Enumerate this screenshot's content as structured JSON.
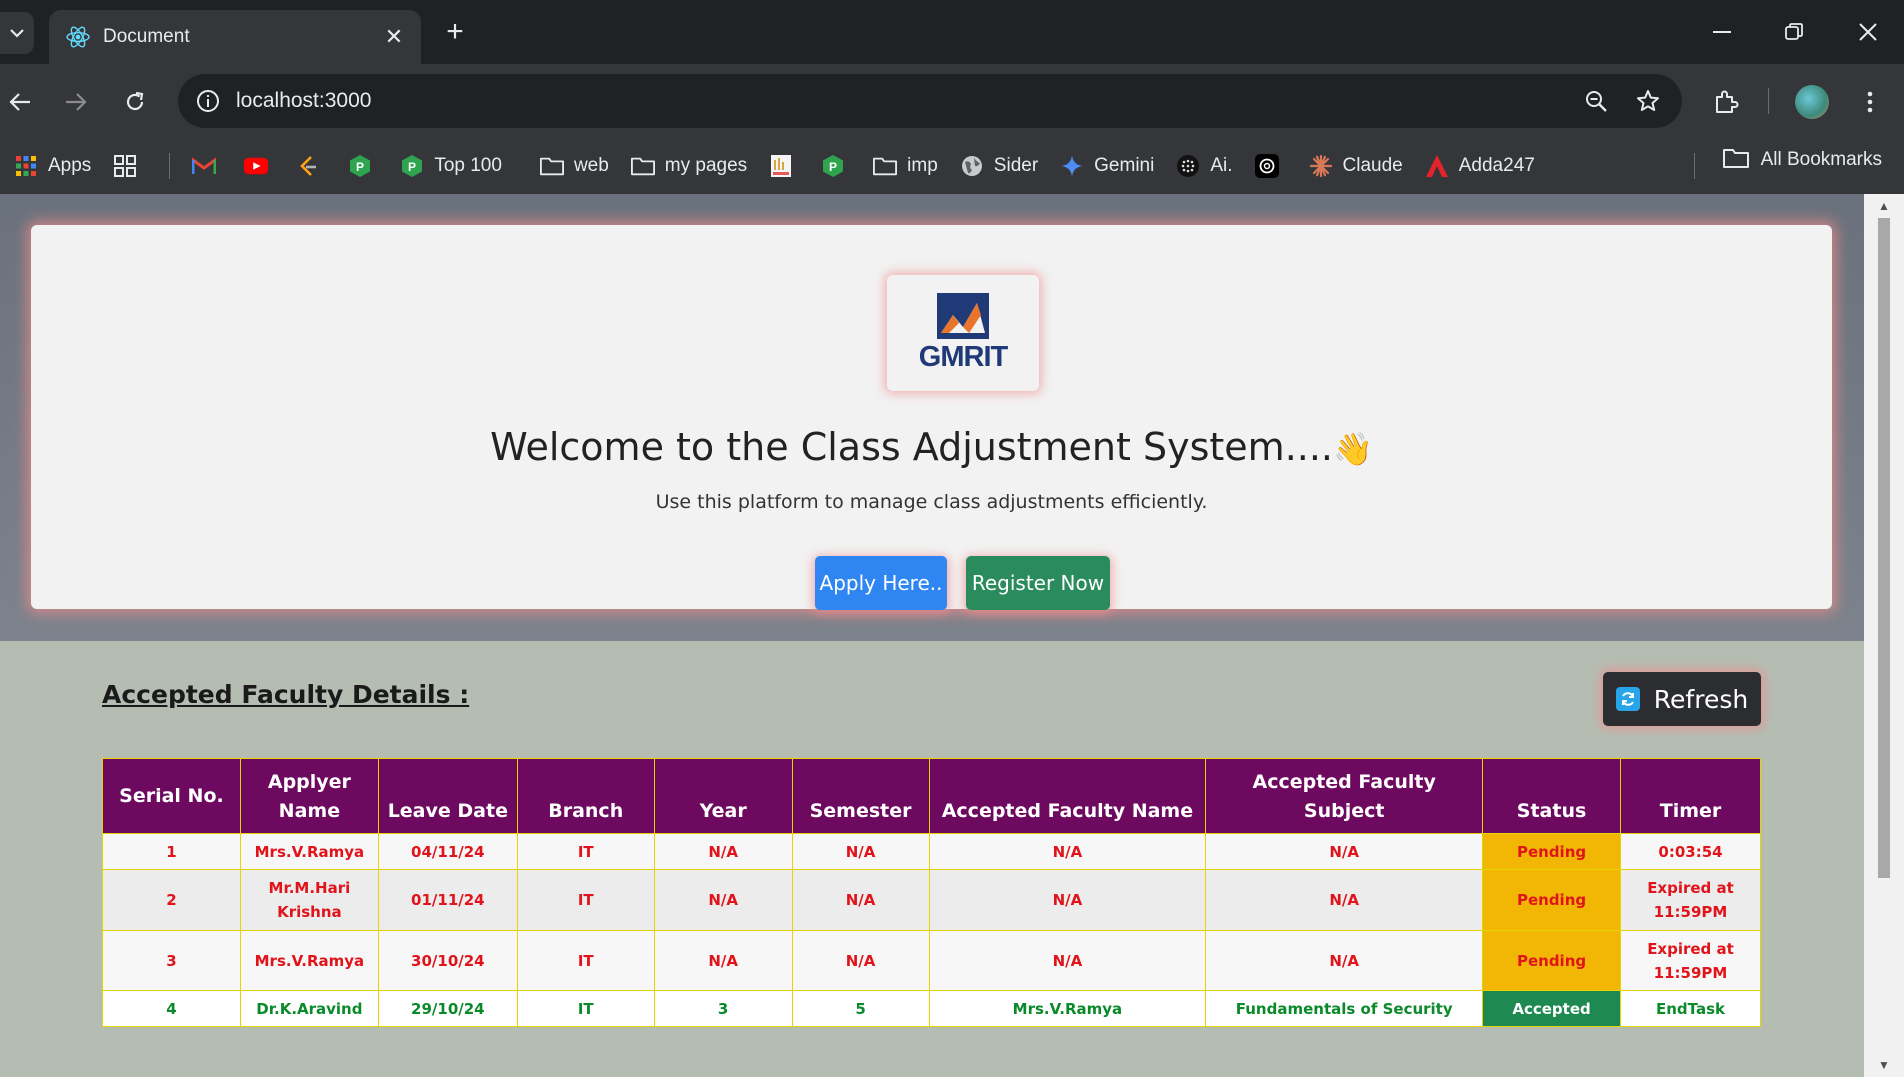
{
  "browser": {
    "tab_title": "Document",
    "url": "localhost:3000"
  },
  "bookmarks": {
    "items": [
      "Apps",
      "",
      "",
      "",
      "",
      "",
      "Top 100",
      "web",
      "my pages",
      "",
      "",
      "imp",
      "Sider",
      "Gemini",
      "Ai.",
      "",
      "Claude",
      "Adda247"
    ],
    "all_label": "All Bookmarks"
  },
  "hero": {
    "logo_text": "GMRIT",
    "welcome": "Welcome to the Class Adjustment System....",
    "wave": "👋",
    "subtitle": "Use this platform to manage class adjustments efficiently.",
    "apply_label": "Apply Here..",
    "register_label": "Register Now"
  },
  "section": {
    "title": "Accepted Faculty Details :",
    "refresh_label": "Refresh"
  },
  "table": {
    "headers": [
      "Serial No.",
      "Applyer Name",
      "Leave Date",
      "Branch",
      "Year",
      "Semester",
      "Accepted Faculty Name",
      "Accepted Faculty Subject",
      "Status",
      "Timer"
    ],
    "rows": [
      {
        "serial": "1",
        "name": "Mrs.V.Ramya",
        "date": "04/11/24",
        "branch": "IT",
        "year": "N/A",
        "semester": "N/A",
        "faculty": "N/A",
        "subject": "N/A",
        "status": "Pending",
        "timer": "0:03:54"
      },
      {
        "serial": "2",
        "name": "Mr.M.Hari Krishna",
        "date": "01/11/24",
        "branch": "IT",
        "year": "N/A",
        "semester": "N/A",
        "faculty": "N/A",
        "subject": "N/A",
        "status": "Pending",
        "timer": "Expired at 11:59PM"
      },
      {
        "serial": "3",
        "name": "Mrs.V.Ramya",
        "date": "30/10/24",
        "branch": "IT",
        "year": "N/A",
        "semester": "N/A",
        "faculty": "N/A",
        "subject": "N/A",
        "status": "Pending",
        "timer": "Expired at 11:59PM"
      },
      {
        "serial": "4",
        "name": "Dr.K.Aravind",
        "date": "29/10/24",
        "branch": "IT",
        "year": "3",
        "semester": "5",
        "faculty": "Mrs.V.Ramya",
        "subject": "Fundamentals of Security",
        "status": "Accepted",
        "timer": "EndTask"
      }
    ]
  },
  "colors": {
    "header_bg": "#6d0a60",
    "pending": "#f2b705",
    "accepted": "#1e8a52",
    "apply_btn": "#2f86f2",
    "register_btn": "#2a8b5c"
  }
}
